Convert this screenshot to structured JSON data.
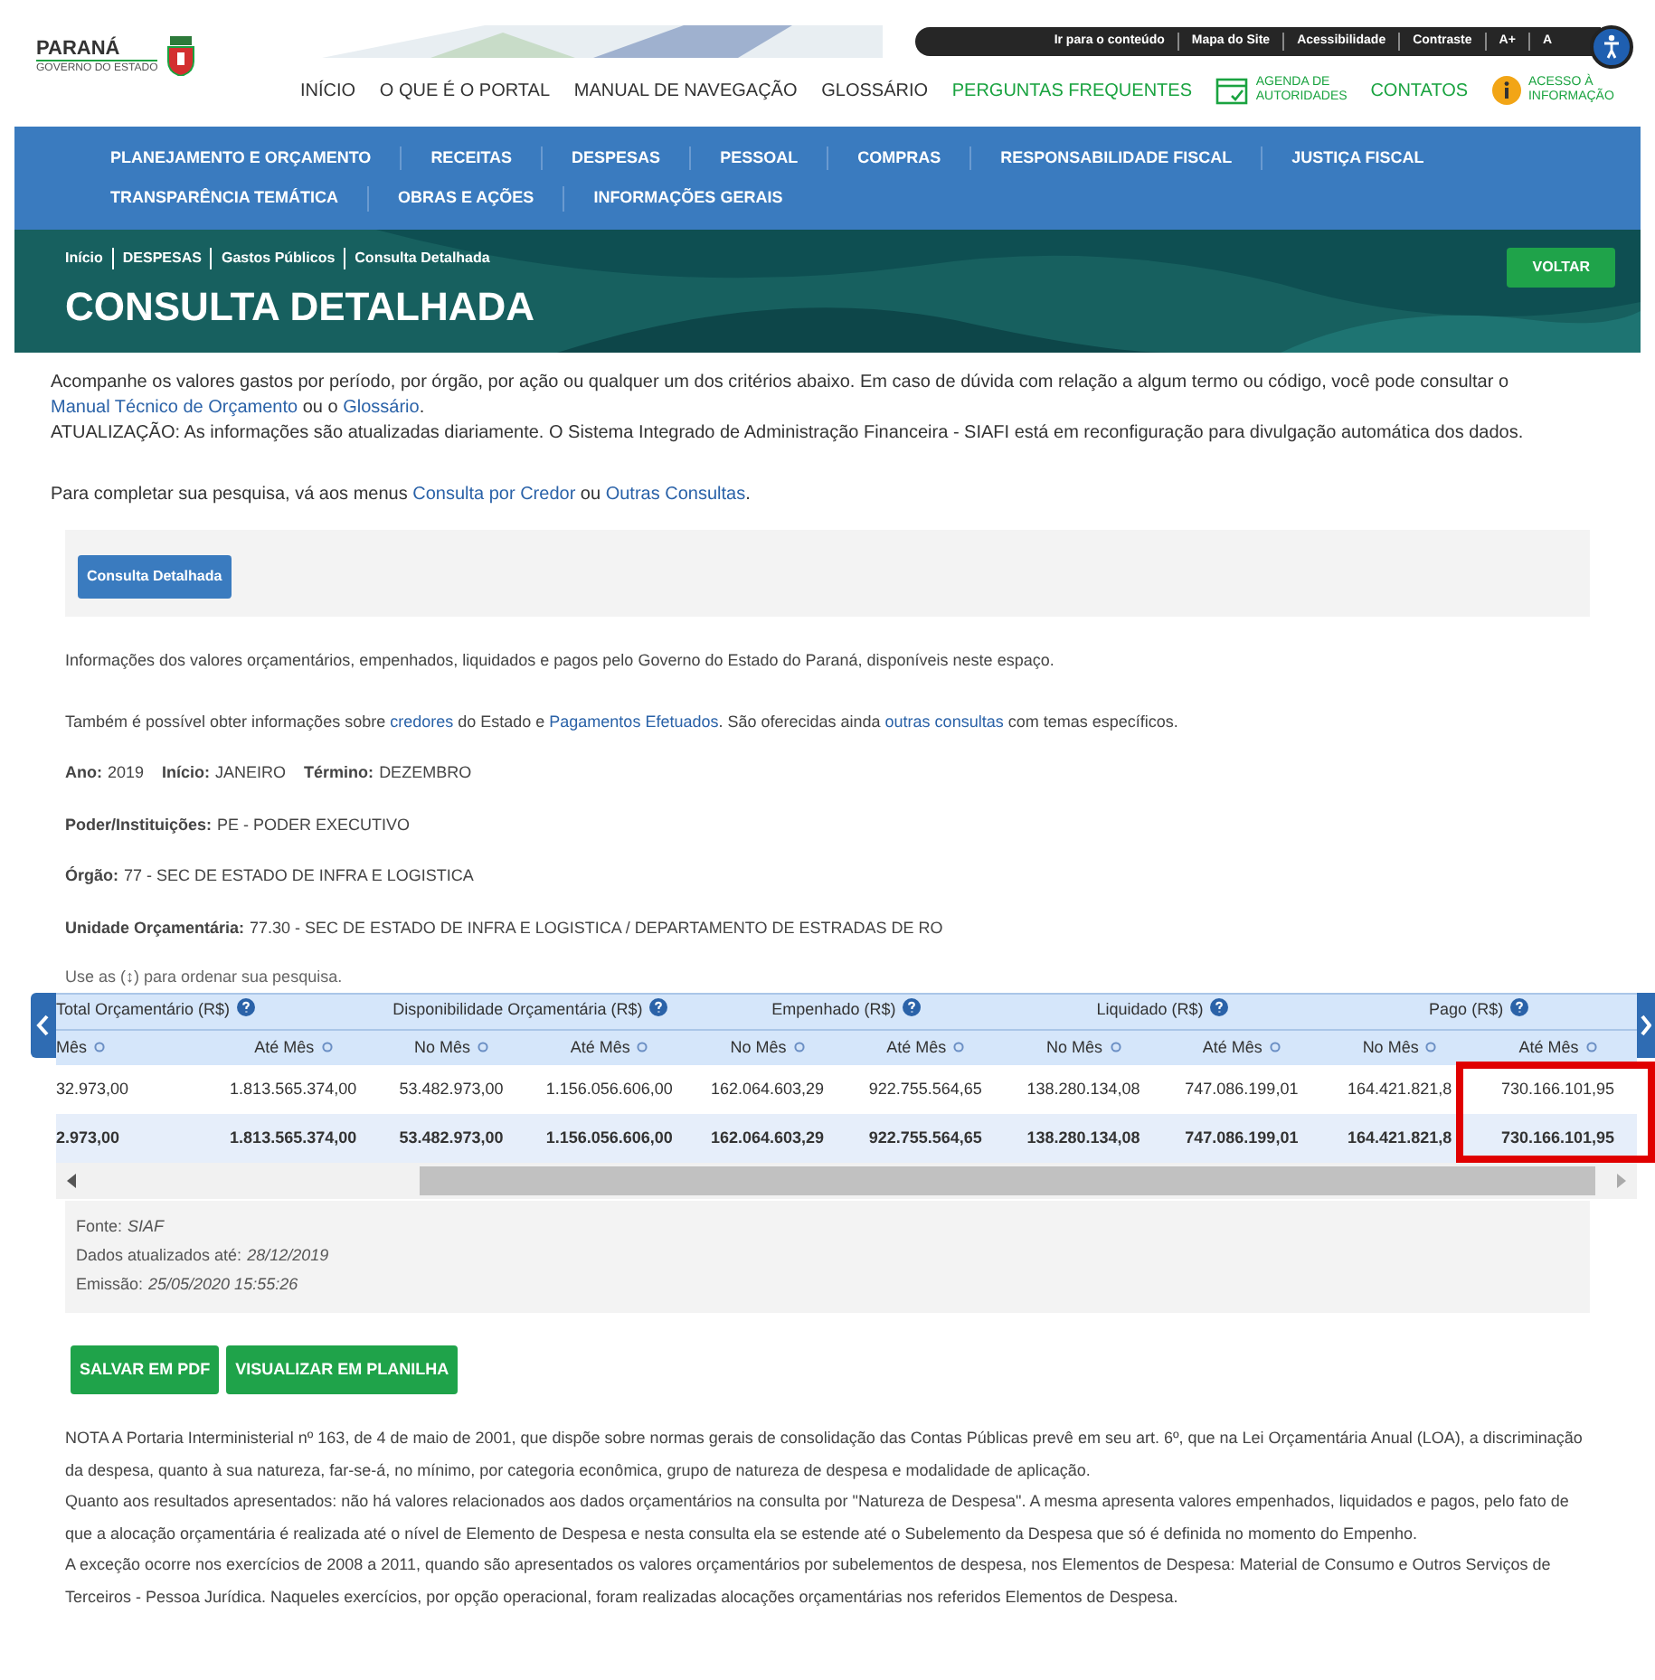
{
  "top_bar": {
    "links": [
      "Ir para o conteúdo",
      "Mapa do Site",
      "Acessibilidade",
      "Contraste",
      "A+",
      "A"
    ]
  },
  "logo": {
    "title": "PARANÁ",
    "subtitle": "GOVERNO DO ESTADO"
  },
  "main_menu": [
    {
      "label": "INÍCIO",
      "kind": "plain"
    },
    {
      "label": "O QUE É O PORTAL",
      "kind": "plain"
    },
    {
      "label": "MANUAL DE NAVEGAÇÃO",
      "kind": "plain"
    },
    {
      "label": "GLOSSÁRIO",
      "kind": "plain"
    },
    {
      "label": "PERGUNTAS FREQUENTES",
      "kind": "accent"
    },
    {
      "label": "AGENDA DE AUTORIDADES",
      "kind": "calendar"
    },
    {
      "label": "CONTATOS",
      "kind": "accent"
    },
    {
      "label": "ACESSO À INFORMAÇÃO",
      "kind": "info"
    }
  ],
  "nav": [
    [
      "PLANEJAMENTO E ORÇAMENTO",
      "RECEITAS",
      "DESPESAS",
      "PESSOAL",
      "COMPRAS",
      "RESPONSABILIDADE FISCAL",
      "JUSTIÇA FISCAL"
    ],
    [
      "TRANSPARÊNCIA TEMÁTICA",
      "OBRAS E AÇÕES",
      "INFORMAÇÕES GERAIS"
    ]
  ],
  "banner": {
    "breadcrumb": [
      "Início",
      "DESPESAS",
      "Gastos Públicos",
      "Consulta Detalhada"
    ],
    "title": "CONSULTA DETALHADA",
    "back_button": "VOLTAR"
  },
  "intro": [
    [
      {
        "text": "Acompanhe os valores gastos por período, por órgão, por ação ou qualquer um dos critérios abaixo. Em caso de dúvida com relação a algum termo ou código, você pode consultar o "
      },
      {
        "text": "Manual Técnico de Orçamento",
        "link": true
      },
      {
        "text": " ou o "
      },
      {
        "text": "Glossário",
        "link": true
      },
      {
        "text": "."
      }
    ],
    [
      {
        "text": "ATUALIZAÇÃO: As informações são atualizadas diariamente. O Sistema Integrado de Administração Financeira - SIAFI está em reconfiguração para divulgação automática dos dados."
      }
    ],
    [
      {
        "text": "Para completar sua pesquisa, vá aos menus "
      },
      {
        "text": "Consulta por Credor",
        "link": true
      },
      {
        "text": " ou "
      },
      {
        "text": "Outras Consultas",
        "link": true
      },
      {
        "text": "."
      }
    ]
  ],
  "query_tab": "Consulta Detalhada",
  "description": [
    [
      {
        "text": "Informações dos valores orçamentários, empenhados, liquidados e pagos pelo Governo do Estado do Paraná, disponíveis neste espaço."
      }
    ],
    [
      {
        "text": "Também é possível obter informações sobre "
      },
      {
        "text": "credores",
        "link": true
      },
      {
        "text": " do Estado e "
      },
      {
        "text": "Pagamentos Efetuados",
        "link": true
      },
      {
        "text": ". São oferecidas ainda "
      },
      {
        "text": "outras consultas",
        "link": true
      },
      {
        "text": " com temas específicos."
      }
    ]
  ],
  "filters": [
    [
      {
        "label": "Ano:",
        "value": "2019"
      },
      {
        "label": "Início:",
        "value": "JANEIRO"
      },
      {
        "label": "Término:",
        "value": "DEZEMBRO"
      }
    ],
    [
      {
        "label": "Poder/Instituições:",
        "value": "PE - PODER EXECUTIVO"
      }
    ],
    [
      {
        "label": "Órgão:",
        "value": "77 - SEC DE ESTADO DE INFRA E LOGISTICA"
      }
    ],
    [
      {
        "label": "Unidade Orçamentária:",
        "value": "77.30 - SEC DE ESTADO DE INFRA E LOGISTICA / DEPARTAMENTO DE ESTRADAS DE RO"
      }
    ]
  ],
  "sort_hint": "Use as (↕) para ordenar sua pesquisa.",
  "table": {
    "groups": [
      "Total Orçamentário (R$)",
      "Disponibilidade Orçamentária (R$)",
      "Empenhado (R$)",
      "Liquidado (R$)",
      "Pago (R$)"
    ],
    "columns": [
      "Mês",
      "Até Mês",
      "No Mês",
      "Até Mês",
      "No Mês",
      "Até Mês",
      "No Mês",
      "Até Mês",
      "No Mês",
      "Até Mês"
    ],
    "rows": [
      {
        "kind": "data",
        "cells": [
          "32.973,00",
          "1.813.565.374,00",
          "53.482.973,00",
          "1.156.056.606,00",
          "162.064.603,29",
          "922.755.564,65",
          "138.280.134,08",
          "747.086.199,01",
          "164.421.821,8",
          "730.166.101,95"
        ]
      },
      {
        "kind": "total",
        "cells": [
          "2.973,00",
          "1.813.565.374,00",
          "53.482.973,00",
          "1.156.056.606,00",
          "162.064.603,29",
          "922.755.564,65",
          "138.280.134,08",
          "747.086.199,01",
          "164.421.821,8",
          "730.166.101,95"
        ]
      }
    ]
  },
  "footer": [
    {
      "label": "Fonte:",
      "value": "SIAF"
    },
    {
      "label": "Dados atualizados até:",
      "value": "28/12/2019"
    },
    {
      "label": "Emissão:",
      "value": "25/05/2020 15:55:26"
    }
  ],
  "buttons": [
    "SALVAR EM PDF",
    "VISUALIZAR EM PLANILHA"
  ],
  "note": [
    "NOTA A Portaria Interministerial nº 163, de 4 de maio de 2001, que dispõe sobre normas gerais de consolidação das Contas Públicas prevê em seu art. 6º, que na Lei Orçamentária Anual (LOA), a discriminação da despesa, quanto à sua natureza, far-se-á, no mínimo, por categoria econômica, grupo de natureza de despesa e modalidade de aplicação.",
    "Quanto aos resultados apresentados: não há valores relacionados aos dados orçamentários na consulta por \"Natureza de Despesa\". A mesma apresenta valores empenhados, liquidados e pagos, pelo fato de que a alocação orçamentária é realizada até o nível de Elemento de Despesa e nesta consulta ela se estende até o Subelemento da Despesa que só é definida no momento do Empenho.",
    "A exceção ocorre nos exercícios de 2008 a 2011, quando são apresentados os valores orçamentários por subelementos de despesa, nos Elementos de Despesa: Material de Consumo e Outros Serviços de Terceiros - Pessoa Jurídica. Naqueles exercícios, por opção operacional, foram realizadas alocações orçamentárias nos referidos Elementos de Despesa."
  ]
}
